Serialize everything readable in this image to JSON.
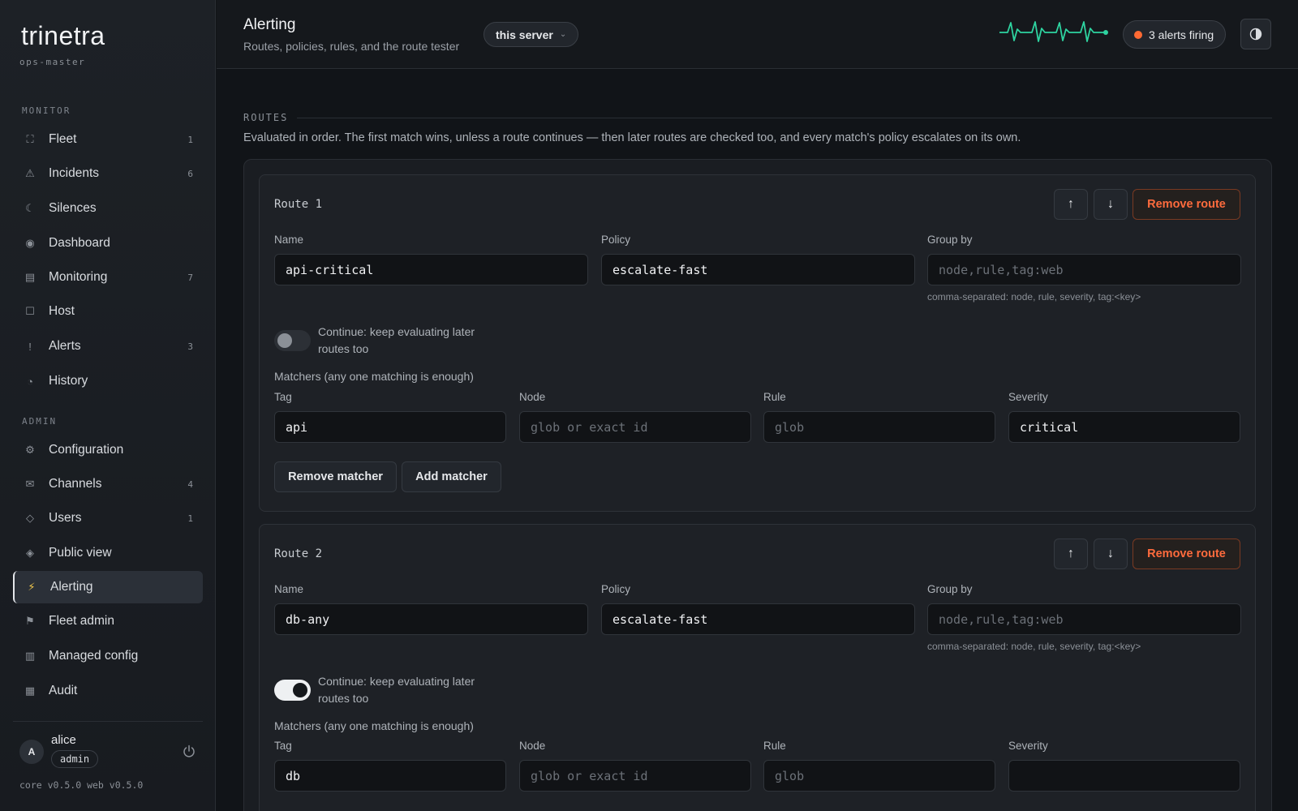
{
  "app": {
    "logo": "trinetra",
    "server_name": "ops-master"
  },
  "sidebar": {
    "monitor_label": "MONITOR",
    "admin_label": "ADMIN",
    "monitor_items": [
      {
        "label": "Fleet",
        "count": "1",
        "icon": "fleet-icon"
      },
      {
        "label": "Incidents",
        "count": "6",
        "icon": "warning-triangle-icon"
      },
      {
        "label": "Silences",
        "count": "",
        "icon": "moon-icon"
      },
      {
        "label": "Dashboard",
        "count": "",
        "icon": "dot-circle-icon"
      },
      {
        "label": "Monitoring",
        "count": "7",
        "icon": "monitor-list-icon"
      },
      {
        "label": "Host",
        "count": "",
        "icon": "square-icon"
      },
      {
        "label": "Alerts",
        "count": "3",
        "icon": "exclamation-icon"
      },
      {
        "label": "History",
        "count": "",
        "icon": "clock-icon"
      }
    ],
    "admin_items": [
      {
        "label": "Configuration",
        "count": "",
        "icon": "gear-icon"
      },
      {
        "label": "Channels",
        "count": "4",
        "icon": "envelope-icon"
      },
      {
        "label": "Users",
        "count": "1",
        "icon": "diamond-icon"
      },
      {
        "label": "Public view",
        "count": "",
        "icon": "eye-icon"
      },
      {
        "label": "Alerting",
        "count": "",
        "icon": "lightning-icon",
        "active": true
      },
      {
        "label": "Fleet admin",
        "count": "",
        "icon": "flag-icon"
      },
      {
        "label": "Managed config",
        "count": "",
        "icon": "grid-icon"
      },
      {
        "label": "Audit",
        "count": "",
        "icon": "table-icon"
      }
    ],
    "user": {
      "initial": "A",
      "name": "alice",
      "role": "admin"
    },
    "versions": "core v0.5.0  web v0.5.0"
  },
  "header": {
    "title": "Alerting",
    "subtitle": "Routes, policies, rules, and the route tester",
    "server_select": "this server",
    "alerts_firing": "3 alerts firing",
    "accent_color": "#2ed3a0",
    "alert_dot_color": "#ff6a33"
  },
  "routes": {
    "section_label": "ROUTES",
    "description": "Evaluated in order. The first match wins, unless a route continues — then later routes are checked too, and every match's policy escalates on its own.",
    "remove_route_label": "Remove route",
    "up_label": "↑",
    "down_label": "↓",
    "name_label": "Name",
    "policy_label": "Policy",
    "group_by_label": "Group by",
    "group_by_placeholder": "node,rule,tag:web",
    "group_by_hint": "comma-separated: node, rule, severity, tag:<key>",
    "continue_label": "Continue: keep evaluating later routes too",
    "matchers_label": "Matchers (any one matching is enough)",
    "tag_label": "Tag",
    "node_label": "Node",
    "rule_label": "Rule",
    "severity_label": "Severity",
    "node_placeholder": "glob or exact id",
    "rule_placeholder": "glob",
    "remove_matcher_label": "Remove matcher",
    "add_matcher_label": "Add matcher",
    "items": [
      {
        "title": "Route 1",
        "name": "api-critical",
        "policy": "escalate-fast",
        "continue": false,
        "tag": "api",
        "severity": "critical"
      },
      {
        "title": "Route 2",
        "name": "db-any",
        "policy": "escalate-fast",
        "continue": true,
        "tag": "db",
        "severity": ""
      }
    ]
  }
}
